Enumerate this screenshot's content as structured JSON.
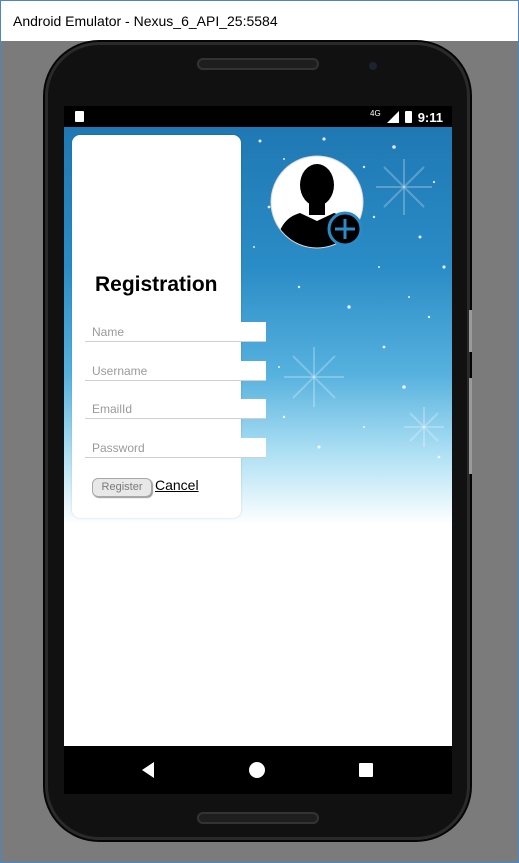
{
  "window": {
    "title": "Android Emulator - Nexus_6_API_25:5584"
  },
  "statusbar": {
    "network": "4G",
    "time": "9:11"
  },
  "form": {
    "title": "Registration",
    "fields": {
      "name_placeholder": "Name",
      "username_placeholder": "Username",
      "email_placeholder": "EmailId",
      "password_placeholder": "Password"
    },
    "register_label": "Register",
    "cancel_label": "Cancel"
  },
  "icons": {
    "avatar": "add-user-avatar-icon",
    "nav_back": "back-triangle-icon",
    "nav_home": "home-circle-icon",
    "nav_recent": "recent-apps-square-icon"
  },
  "colors": {
    "accent": "#2a8cc6",
    "window_border": "#4a87c5"
  }
}
